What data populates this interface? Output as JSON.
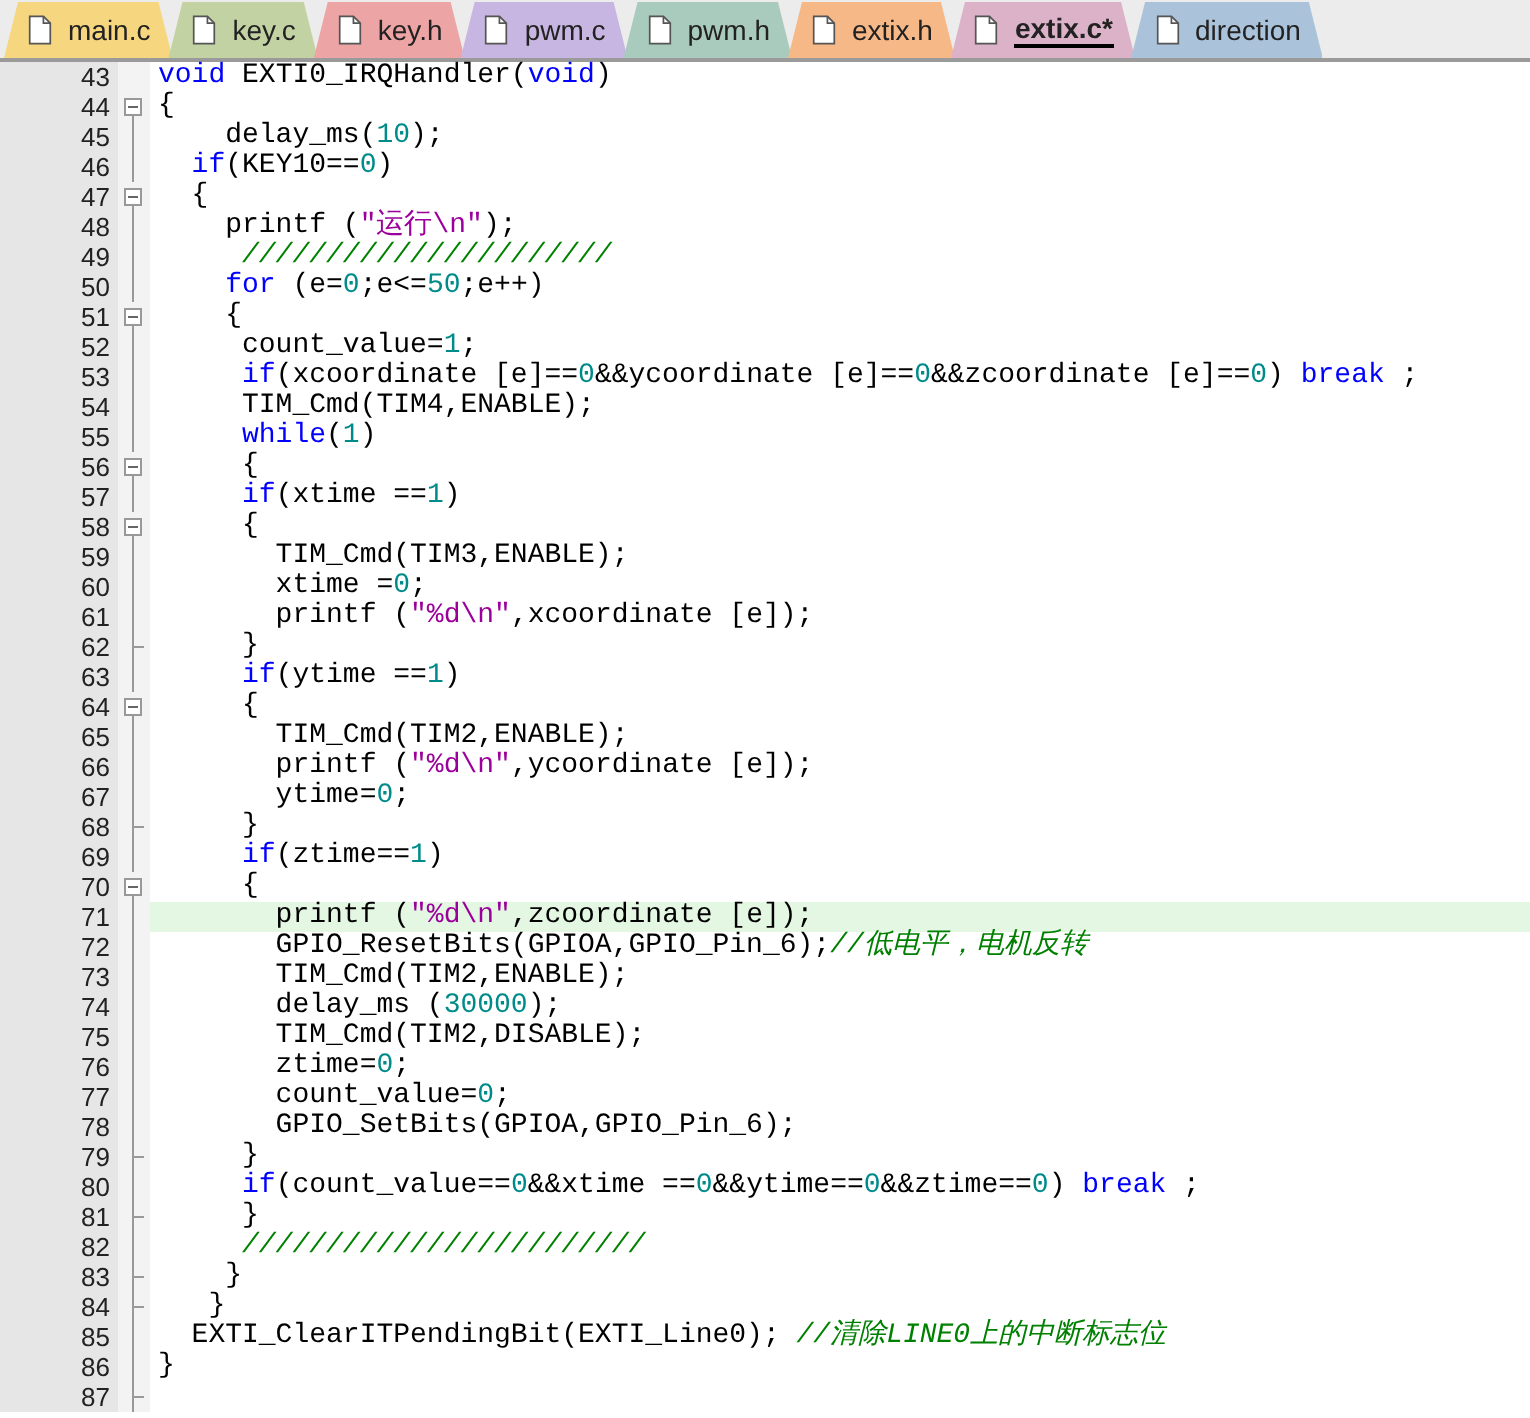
{
  "tabs": [
    {
      "label": "main.c",
      "selected": false,
      "color": "#f6d67e"
    },
    {
      "label": "key.c",
      "selected": false,
      "color": "#c3d2a2"
    },
    {
      "label": "key.h",
      "selected": false,
      "color": "#eda4a4"
    },
    {
      "label": "pwm.c",
      "selected": false,
      "color": "#c8b6e2"
    },
    {
      "label": "pwm.h",
      "selected": false,
      "color": "#a9cbbd"
    },
    {
      "label": "extix.h",
      "selected": false,
      "color": "#f6b886"
    },
    {
      "label": "extix.c*",
      "selected": true,
      "color": "#dcb2c9"
    },
    {
      "label": "direction",
      "selected": false,
      "color": "#abc3da"
    }
  ],
  "lines": [
    {
      "number": "43",
      "in_fold": false,
      "fold_box": false,
      "fold_end": false,
      "current": false,
      "tokens": [
        {
          "kind": "keyword",
          "text": "void"
        },
        {
          "kind": "plain",
          "text": " EXTI0_IRQHandler("
        },
        {
          "kind": "keyword",
          "text": "void"
        },
        {
          "kind": "plain",
          "text": ")"
        }
      ]
    },
    {
      "number": "44",
      "in_fold": true,
      "fold_box": true,
      "fold_end": false,
      "current": false,
      "tokens": [
        {
          "kind": "plain",
          "text": "{"
        }
      ]
    },
    {
      "number": "45",
      "in_fold": true,
      "fold_box": false,
      "fold_end": false,
      "current": false,
      "tokens": [
        {
          "kind": "plain",
          "text": "    delay_ms("
        },
        {
          "kind": "number",
          "text": "10"
        },
        {
          "kind": "plain",
          "text": ");"
        }
      ]
    },
    {
      "number": "46",
      "in_fold": true,
      "fold_box": false,
      "fold_end": false,
      "current": false,
      "tokens": [
        {
          "kind": "keyword",
          "text": "  if"
        },
        {
          "kind": "plain",
          "text": "(KEY10=="
        },
        {
          "kind": "number",
          "text": "0"
        },
        {
          "kind": "plain",
          "text": ")"
        }
      ]
    },
    {
      "number": "47",
      "in_fold": true,
      "fold_box": true,
      "fold_end": false,
      "current": false,
      "tokens": [
        {
          "kind": "plain",
          "text": "  {"
        }
      ]
    },
    {
      "number": "48",
      "in_fold": true,
      "fold_box": false,
      "fold_end": false,
      "current": false,
      "tokens": [
        {
          "kind": "plain",
          "text": "    printf ("
        },
        {
          "kind": "string",
          "text": "\"运行\\n\""
        },
        {
          "kind": "plain",
          "text": ");"
        }
      ]
    },
    {
      "number": "49",
      "in_fold": true,
      "fold_box": false,
      "fold_end": false,
      "current": false,
      "tokens": [
        {
          "kind": "comment",
          "text": "     //////////////////////"
        }
      ]
    },
    {
      "number": "50",
      "in_fold": true,
      "fold_box": false,
      "fold_end": false,
      "current": false,
      "tokens": [
        {
          "kind": "keyword",
          "text": "    for"
        },
        {
          "kind": "plain",
          "text": " (e="
        },
        {
          "kind": "number",
          "text": "0"
        },
        {
          "kind": "plain",
          "text": ";e<="
        },
        {
          "kind": "number",
          "text": "50"
        },
        {
          "kind": "plain",
          "text": ";e++)"
        }
      ]
    },
    {
      "number": "51",
      "in_fold": true,
      "fold_box": true,
      "fold_end": false,
      "current": false,
      "tokens": [
        {
          "kind": "plain",
          "text": "    {"
        }
      ]
    },
    {
      "number": "52",
      "in_fold": true,
      "fold_box": false,
      "fold_end": false,
      "current": false,
      "tokens": [
        {
          "kind": "plain",
          "text": "     count_value="
        },
        {
          "kind": "number",
          "text": "1"
        },
        {
          "kind": "plain",
          "text": ";"
        }
      ]
    },
    {
      "number": "53",
      "in_fold": true,
      "fold_box": false,
      "fold_end": false,
      "current": false,
      "tokens": [
        {
          "kind": "keyword",
          "text": "     if"
        },
        {
          "kind": "plain",
          "text": "(xcoordinate [e]=="
        },
        {
          "kind": "number",
          "text": "0"
        },
        {
          "kind": "plain",
          "text": "&&ycoordinate [e]=="
        },
        {
          "kind": "number",
          "text": "0"
        },
        {
          "kind": "plain",
          "text": "&&zcoordinate [e]=="
        },
        {
          "kind": "number",
          "text": "0"
        },
        {
          "kind": "plain",
          "text": ") "
        },
        {
          "kind": "keyword",
          "text": "break"
        },
        {
          "kind": "plain",
          "text": " ;"
        }
      ]
    },
    {
      "number": "54",
      "in_fold": true,
      "fold_box": false,
      "fold_end": false,
      "current": false,
      "tokens": [
        {
          "kind": "plain",
          "text": "     TIM_Cmd(TIM4,ENABLE);"
        }
      ]
    },
    {
      "number": "55",
      "in_fold": true,
      "fold_box": false,
      "fold_end": false,
      "current": false,
      "tokens": [
        {
          "kind": "keyword",
          "text": "     while"
        },
        {
          "kind": "plain",
          "text": "("
        },
        {
          "kind": "number",
          "text": "1"
        },
        {
          "kind": "plain",
          "text": ")"
        }
      ]
    },
    {
      "number": "56",
      "in_fold": true,
      "fold_box": true,
      "fold_end": false,
      "current": false,
      "tokens": [
        {
          "kind": "plain",
          "text": "     {"
        }
      ]
    },
    {
      "number": "57",
      "in_fold": true,
      "fold_box": false,
      "fold_end": false,
      "current": false,
      "tokens": [
        {
          "kind": "keyword",
          "text": "     if"
        },
        {
          "kind": "plain",
          "text": "(xtime =="
        },
        {
          "kind": "number",
          "text": "1"
        },
        {
          "kind": "plain",
          "text": ")"
        }
      ]
    },
    {
      "number": "58",
      "in_fold": true,
      "fold_box": true,
      "fold_end": false,
      "current": false,
      "tokens": [
        {
          "kind": "plain",
          "text": "     {"
        }
      ]
    },
    {
      "number": "59",
      "in_fold": true,
      "fold_box": false,
      "fold_end": false,
      "current": false,
      "tokens": [
        {
          "kind": "plain",
          "text": "       TIM_Cmd(TIM3,ENABLE);"
        }
      ]
    },
    {
      "number": "60",
      "in_fold": true,
      "fold_box": false,
      "fold_end": false,
      "current": false,
      "tokens": [
        {
          "kind": "plain",
          "text": "       xtime ="
        },
        {
          "kind": "number",
          "text": "0"
        },
        {
          "kind": "plain",
          "text": ";"
        }
      ]
    },
    {
      "number": "61",
      "in_fold": true,
      "fold_box": false,
      "fold_end": false,
      "current": false,
      "tokens": [
        {
          "kind": "plain",
          "text": "       printf ("
        },
        {
          "kind": "string",
          "text": "\"%d\\n\""
        },
        {
          "kind": "plain",
          "text": ",xcoordinate [e]);"
        }
      ]
    },
    {
      "number": "62",
      "in_fold": true,
      "fold_box": false,
      "fold_end": true,
      "current": false,
      "tokens": [
        {
          "kind": "plain",
          "text": "     }"
        }
      ]
    },
    {
      "number": "63",
      "in_fold": true,
      "fold_box": false,
      "fold_end": false,
      "current": false,
      "tokens": [
        {
          "kind": "keyword",
          "text": "     if"
        },
        {
          "kind": "plain",
          "text": "(ytime =="
        },
        {
          "kind": "number",
          "text": "1"
        },
        {
          "kind": "plain",
          "text": ")"
        }
      ]
    },
    {
      "number": "64",
      "in_fold": true,
      "fold_box": true,
      "fold_end": false,
      "current": false,
      "tokens": [
        {
          "kind": "plain",
          "text": "     {"
        }
      ]
    },
    {
      "number": "65",
      "in_fold": true,
      "fold_box": false,
      "fold_end": false,
      "current": false,
      "tokens": [
        {
          "kind": "plain",
          "text": "       TIM_Cmd(TIM2,ENABLE);"
        }
      ]
    },
    {
      "number": "66",
      "in_fold": true,
      "fold_box": false,
      "fold_end": false,
      "current": false,
      "tokens": [
        {
          "kind": "plain",
          "text": "       printf ("
        },
        {
          "kind": "string",
          "text": "\"%d\\n\""
        },
        {
          "kind": "plain",
          "text": ",ycoordinate [e]);"
        }
      ]
    },
    {
      "number": "67",
      "in_fold": true,
      "fold_box": false,
      "fold_end": false,
      "current": false,
      "tokens": [
        {
          "kind": "plain",
          "text": "       ytime="
        },
        {
          "kind": "number",
          "text": "0"
        },
        {
          "kind": "plain",
          "text": ";"
        }
      ]
    },
    {
      "number": "68",
      "in_fold": true,
      "fold_box": false,
      "fold_end": true,
      "current": false,
      "tokens": [
        {
          "kind": "plain",
          "text": "     }"
        }
      ]
    },
    {
      "number": "69",
      "in_fold": true,
      "fold_box": false,
      "fold_end": false,
      "current": false,
      "tokens": [
        {
          "kind": "keyword",
          "text": "     if"
        },
        {
          "kind": "plain",
          "text": "(ztime=="
        },
        {
          "kind": "number",
          "text": "1"
        },
        {
          "kind": "plain",
          "text": ")"
        }
      ]
    },
    {
      "number": "70",
      "in_fold": true,
      "fold_box": true,
      "fold_end": false,
      "current": false,
      "tokens": [
        {
          "kind": "plain",
          "text": "     {"
        }
      ]
    },
    {
      "number": "71",
      "in_fold": true,
      "fold_box": false,
      "fold_end": false,
      "current": true,
      "tokens": [
        {
          "kind": "plain",
          "text": "       printf ("
        },
        {
          "kind": "string",
          "text": "\"%d\\n\""
        },
        {
          "kind": "plain",
          "text": ",zcoordinate [e]);"
        }
      ]
    },
    {
      "number": "72",
      "in_fold": true,
      "fold_box": false,
      "fold_end": false,
      "current": false,
      "tokens": [
        {
          "kind": "plain",
          "text": "       GPIO_ResetBits(GPIOA,GPIO_Pin_6);"
        },
        {
          "kind": "comment",
          "text": "//低电平，电机反转"
        }
      ]
    },
    {
      "number": "73",
      "in_fold": true,
      "fold_box": false,
      "fold_end": false,
      "current": false,
      "tokens": [
        {
          "kind": "plain",
          "text": "       TIM_Cmd(TIM2,ENABLE);"
        }
      ]
    },
    {
      "number": "74",
      "in_fold": true,
      "fold_box": false,
      "fold_end": false,
      "current": false,
      "tokens": [
        {
          "kind": "plain",
          "text": "       delay_ms ("
        },
        {
          "kind": "number",
          "text": "30000"
        },
        {
          "kind": "plain",
          "text": ");"
        }
      ]
    },
    {
      "number": "75",
      "in_fold": true,
      "fold_box": false,
      "fold_end": false,
      "current": false,
      "tokens": [
        {
          "kind": "plain",
          "text": "       TIM_Cmd(TIM2,DISABLE);"
        }
      ]
    },
    {
      "number": "76",
      "in_fold": true,
      "fold_box": false,
      "fold_end": false,
      "current": false,
      "tokens": [
        {
          "kind": "plain",
          "text": "       ztime="
        },
        {
          "kind": "number",
          "text": "0"
        },
        {
          "kind": "plain",
          "text": ";"
        }
      ]
    },
    {
      "number": "77",
      "in_fold": true,
      "fold_box": false,
      "fold_end": false,
      "current": false,
      "tokens": [
        {
          "kind": "plain",
          "text": "       count_value="
        },
        {
          "kind": "number",
          "text": "0"
        },
        {
          "kind": "plain",
          "text": ";"
        }
      ]
    },
    {
      "number": "78",
      "in_fold": true,
      "fold_box": false,
      "fold_end": false,
      "current": false,
      "tokens": [
        {
          "kind": "plain",
          "text": "       GPIO_SetBits(GPIOA,GPIO_Pin_6);"
        }
      ]
    },
    {
      "number": "79",
      "in_fold": true,
      "fold_box": false,
      "fold_end": true,
      "current": false,
      "tokens": [
        {
          "kind": "plain",
          "text": "     }"
        }
      ]
    },
    {
      "number": "80",
      "in_fold": true,
      "fold_box": false,
      "fold_end": false,
      "current": false,
      "tokens": [
        {
          "kind": "keyword",
          "text": "     if"
        },
        {
          "kind": "plain",
          "text": "(count_value=="
        },
        {
          "kind": "number",
          "text": "0"
        },
        {
          "kind": "plain",
          "text": "&&xtime =="
        },
        {
          "kind": "number",
          "text": "0"
        },
        {
          "kind": "plain",
          "text": "&&ytime=="
        },
        {
          "kind": "number",
          "text": "0"
        },
        {
          "kind": "plain",
          "text": "&&ztime=="
        },
        {
          "kind": "number",
          "text": "0"
        },
        {
          "kind": "plain",
          "text": ") "
        },
        {
          "kind": "keyword",
          "text": "break"
        },
        {
          "kind": "plain",
          "text": " ;"
        }
      ]
    },
    {
      "number": "81",
      "in_fold": true,
      "fold_box": false,
      "fold_end": true,
      "current": false,
      "tokens": [
        {
          "kind": "plain",
          "text": "     }"
        }
      ]
    },
    {
      "number": "82",
      "in_fold": true,
      "fold_box": false,
      "fold_end": false,
      "current": false,
      "tokens": [
        {
          "kind": "comment",
          "text": "     ////////////////////////"
        }
      ]
    },
    {
      "number": "83",
      "in_fold": true,
      "fold_box": false,
      "fold_end": true,
      "current": false,
      "tokens": [
        {
          "kind": "plain",
          "text": "    }"
        }
      ]
    },
    {
      "number": "84",
      "in_fold": true,
      "fold_box": false,
      "fold_end": true,
      "current": false,
      "tokens": [
        {
          "kind": "plain",
          "text": "   }"
        }
      ]
    },
    {
      "number": "85",
      "in_fold": true,
      "fold_box": false,
      "fold_end": false,
      "current": false,
      "tokens": [
        {
          "kind": "plain",
          "text": "  EXTI_ClearITPendingBit(EXTI_Line0); "
        },
        {
          "kind": "comment",
          "text": "//清除LINE0上的中断标志位"
        }
      ]
    },
    {
      "number": "86",
      "in_fold": true,
      "fold_box": false,
      "fold_end": false,
      "current": false,
      "tokens": [
        {
          "kind": "plain",
          "text": "}"
        }
      ]
    },
    {
      "number": "87",
      "in_fold": true,
      "fold_box": false,
      "fold_end": true,
      "current": false
    }
  ]
}
